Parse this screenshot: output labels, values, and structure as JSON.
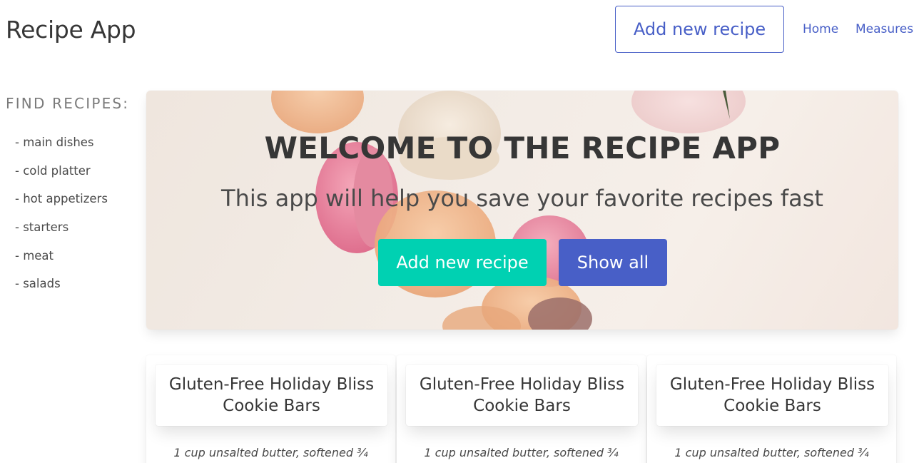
{
  "app": {
    "title": "Recipe App"
  },
  "header": {
    "add_button_label": "Add new recipe",
    "nav": [
      {
        "label": "Home"
      },
      {
        "label": "Measures"
      }
    ]
  },
  "sidebar": {
    "heading": "FIND RECIPES:",
    "items": [
      {
        "label": "- main dishes"
      },
      {
        "label": "- cold platter"
      },
      {
        "label": "- hot appetizers"
      },
      {
        "label": "- starters"
      },
      {
        "label": "- meat"
      },
      {
        "label": "- salads"
      }
    ]
  },
  "hero": {
    "title": "WELCOME TO THE RECIPE APP",
    "subtitle": "This app will help you save your favorite recipes fast",
    "add_button_label": "Add new recipe",
    "show_all_label": "Show all"
  },
  "recipes": [
    {
      "title": "Gluten-Free Holiday Bliss Cookie Bars",
      "snippet": "1 cup unsalted butter, softened ¾"
    },
    {
      "title": "Gluten-Free Holiday Bliss Cookie Bars",
      "snippet": "1 cup unsalted butter, softened ¾"
    },
    {
      "title": "Gluten-Free Holiday Bliss Cookie Bars",
      "snippet": "1 cup unsalted butter, softened ¾"
    }
  ],
  "colors": {
    "primary": "#485fc7",
    "accent": "#00d1b2",
    "text": "#363636",
    "muted": "#7a7a7a"
  }
}
